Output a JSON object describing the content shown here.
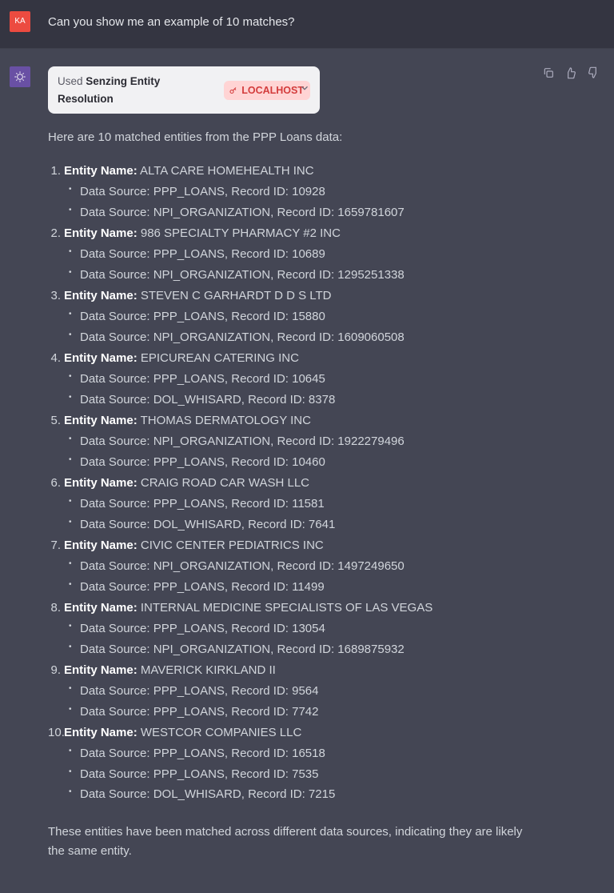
{
  "user": {
    "initials": "KA",
    "message": "Can you show me an example of 10 matches?"
  },
  "tool": {
    "used_prefix": "Used ",
    "name": "Senzing Entity Resolution",
    "badge": "LOCALHOST"
  },
  "intro": "Here are 10 matched entities from the PPP Loans data:",
  "label": "Entity Name:",
  "entities": [
    {
      "name": "ALTA CARE HOMEHEALTH INC",
      "records": [
        "Data Source: PPP_LOANS, Record ID: 10928",
        "Data Source: NPI_ORGANIZATION, Record ID: 1659781607"
      ]
    },
    {
      "name": "986 SPECIALTY PHARMACY #2 INC",
      "records": [
        "Data Source: PPP_LOANS, Record ID: 10689",
        "Data Source: NPI_ORGANIZATION, Record ID: 1295251338"
      ]
    },
    {
      "name": "STEVEN C GARHARDT D D S LTD",
      "records": [
        "Data Source: PPP_LOANS, Record ID: 15880",
        "Data Source: NPI_ORGANIZATION, Record ID: 1609060508"
      ]
    },
    {
      "name": "EPICUREAN CATERING INC",
      "records": [
        "Data Source: PPP_LOANS, Record ID: 10645",
        "Data Source: DOL_WHISARD, Record ID: 8378"
      ]
    },
    {
      "name": "THOMAS DERMATOLOGY INC",
      "records": [
        "Data Source: NPI_ORGANIZATION, Record ID: 1922279496",
        "Data Source: PPP_LOANS, Record ID: 10460"
      ]
    },
    {
      "name": "CRAIG ROAD CAR WASH LLC",
      "records": [
        "Data Source: PPP_LOANS, Record ID: 11581",
        "Data Source: DOL_WHISARD, Record ID: 7641"
      ]
    },
    {
      "name": "CIVIC CENTER PEDIATRICS INC",
      "records": [
        "Data Source: NPI_ORGANIZATION, Record ID: 1497249650",
        "Data Source: PPP_LOANS, Record ID: 11499"
      ]
    },
    {
      "name": "INTERNAL MEDICINE SPECIALISTS OF LAS VEGAS",
      "records": [
        "Data Source: PPP_LOANS, Record ID: 13054",
        "Data Source: NPI_ORGANIZATION, Record ID: 1689875932"
      ]
    },
    {
      "name": "MAVERICK KIRKLAND II",
      "records": [
        "Data Source: PPP_LOANS, Record ID: 9564",
        "Data Source: PPP_LOANS, Record ID: 7742"
      ]
    },
    {
      "name": "WESTCOR COMPANIES LLC",
      "records": [
        "Data Source: PPP_LOANS, Record ID: 16518",
        "Data Source: PPP_LOANS, Record ID: 7535",
        "Data Source: DOL_WHISARD, Record ID: 7215"
      ]
    }
  ],
  "outro": "These entities have been matched across different data sources, indicating they are likely the same entity."
}
